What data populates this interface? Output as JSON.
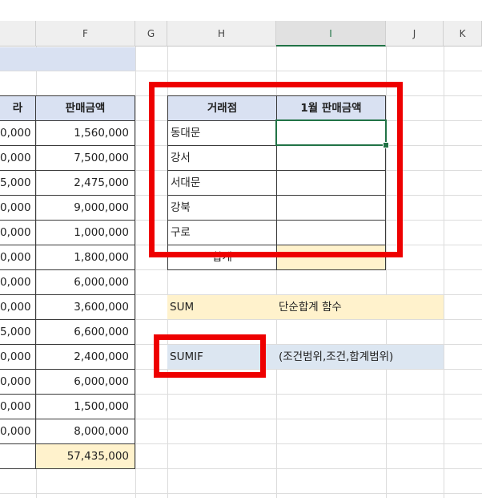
{
  "columns": [
    "F",
    "G",
    "H",
    "I",
    "J",
    "K"
  ],
  "selected_column": "I",
  "left_table": {
    "header_partial": "라",
    "header_amount": "판매금액",
    "partial_values": [
      "0,000",
      "0,000",
      "5,000",
      "0,000",
      "0,000",
      "0,000",
      "0,000",
      "0,000",
      "5,000",
      "0,000",
      "0,000",
      "0,000",
      "0,000"
    ],
    "amounts": [
      "1,560,000",
      "7,500,000",
      "2,475,000",
      "9,000,000",
      "1,000,000",
      "1,800,000",
      "6,000,000",
      "3,600,000",
      "6,600,000",
      "2,400,000",
      "6,000,000",
      "1,500,000",
      "8,000,000"
    ],
    "total": "57,435,000"
  },
  "right_table": {
    "header_store": "거래점",
    "header_jan_sales": "1월 판매금액",
    "stores": [
      "동대문",
      "강서",
      "서대문",
      "강북",
      "구로"
    ],
    "total_label": "합계"
  },
  "notes": {
    "sum_label": "SUM",
    "sum_desc": "단순합계 함수",
    "sumif_label": "SUMIF",
    "sumif_desc": "(조건범위,조건,합계범위)"
  },
  "colors": {
    "header_fill": "#d9e1f2",
    "total_fill": "#fff2cc",
    "sumif_fill": "#dce6f1",
    "annotation_red": "#ee0000",
    "selection_green": "#217346"
  }
}
